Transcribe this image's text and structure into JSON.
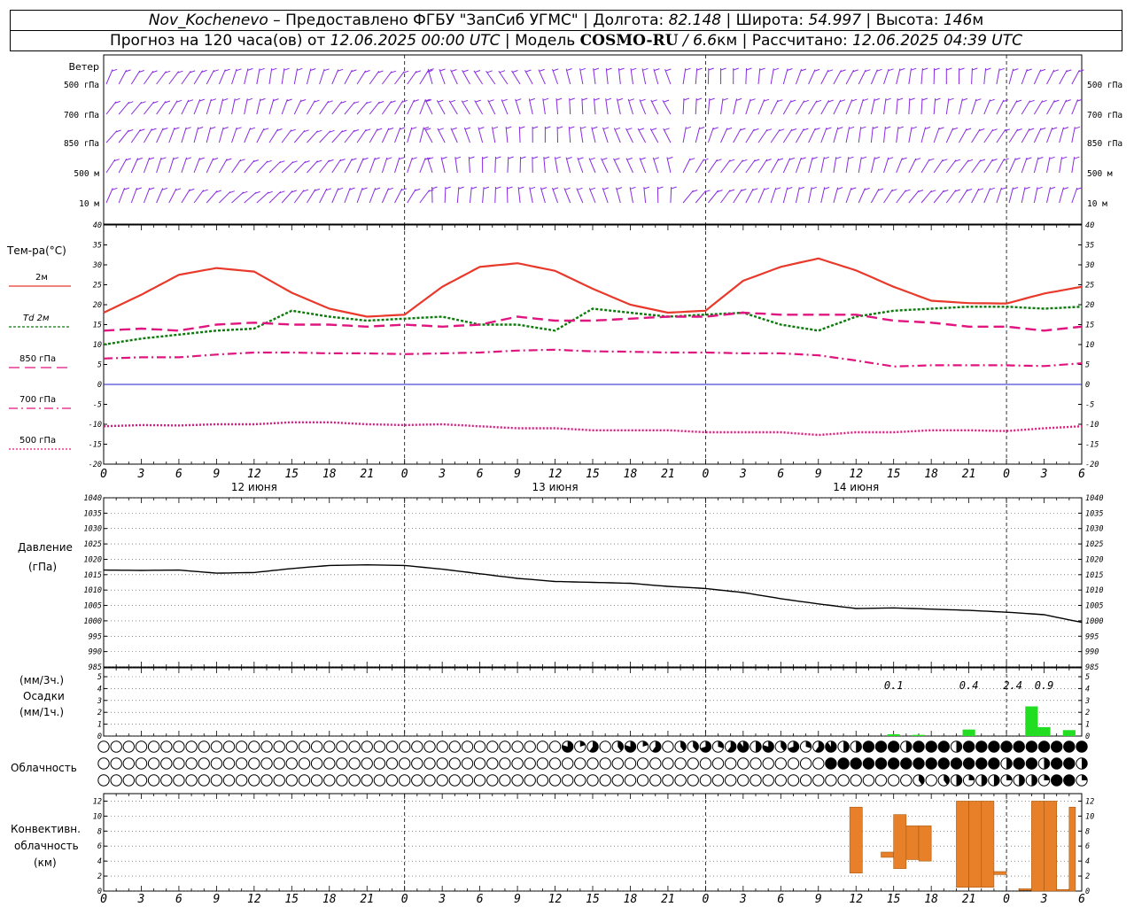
{
  "header": {
    "station": "Nov_Kochenevo",
    "dash": " – ",
    "provided": "Предоставлено ФГБУ \"ЗапСиб УГМС\"",
    "sep": " | ",
    "lon_label": "Долгота: ",
    "lon": "82.148",
    "lat_label": "Широта: ",
    "lat": "54.997",
    "alt_label": "Высота: ",
    "alt": "146",
    "alt_unit": "м",
    "fc_label": "Прогноз на 120 часа(ов) от ",
    "fc_time": "12.06.2025 00:00 UTC",
    "model_label": "Модель ",
    "model": "COSMO-RU",
    "model_res": "6.6",
    "model_res_unit": "км",
    "calc_label": "Рассчитано: ",
    "calc_time": "12.06.2025 04:39 UTC"
  },
  "colors": {
    "t2m": "#e8392b",
    "td2m": "#0b7a0b",
    "t850": "#e0157f",
    "t700": "#e0157f",
    "t500": "#e0157f",
    "wind": "#8a2be2",
    "zero": "#1e1ec8",
    "precip": "#22dd22",
    "conv": "#e8802a"
  },
  "chart_data": [
    {
      "type": "wind_barbs",
      "title": "Ветер",
      "levels": [
        "500 гПа",
        "700 гПа",
        "850 гПа",
        "500 м",
        "10  м"
      ]
    },
    {
      "type": "line",
      "ylabel": "Тем-ра(°C)",
      "ylim": [
        -20,
        40
      ],
      "yticks": [
        -20,
        -15,
        -10,
        -5,
        0,
        5,
        10,
        15,
        20,
        25,
        30,
        35,
        40
      ],
      "x_hours": [
        0,
        3,
        6,
        9,
        12,
        15,
        18,
        21,
        24,
        27,
        30,
        33,
        36,
        39,
        42,
        45,
        48,
        51,
        54,
        57,
        60,
        63,
        66,
        69,
        72,
        75,
        78
      ],
      "series": [
        {
          "name": "2м",
          "values": [
            18,
            22.5,
            27.5,
            29.2,
            28.3,
            23,
            19,
            17,
            17.5,
            24.5,
            29.5,
            30.4,
            28.5,
            24,
            20,
            18,
            18.5,
            26,
            29.5,
            31.6,
            28.6,
            24.5,
            21,
            20.4,
            20.3,
            22.8,
            24.5
          ]
        },
        {
          "name": "Td  2м",
          "values": [
            10,
            11.5,
            12.5,
            13.5,
            14,
            18.5,
            17,
            16,
            16.5,
            17,
            15,
            15,
            13.5,
            19,
            18,
            17,
            17.5,
            18,
            15,
            13.5,
            17,
            18.5,
            19,
            19.5,
            19.5,
            19,
            19.5
          ]
        },
        {
          "name": "850 гПа",
          "values": [
            13.5,
            14,
            13.5,
            15,
            15.5,
            15,
            15,
            14.5,
            15,
            14.5,
            15,
            17,
            16,
            16,
            16.5,
            17,
            17,
            18,
            17.5,
            17.5,
            17.5,
            16,
            15.5,
            14.5,
            14.5,
            13.5,
            14.5
          ]
        },
        {
          "name": "700 гПа",
          "values": [
            6.5,
            6.8,
            6.8,
            7.5,
            8,
            8,
            7.8,
            7.8,
            7.6,
            7.8,
            8,
            8.5,
            8.7,
            8.3,
            8.2,
            8,
            8,
            7.8,
            7.8,
            7.3,
            6,
            4.5,
            4.8,
            4.8,
            4.8,
            4.6,
            5.3
          ]
        },
        {
          "name": "500 гПа",
          "values": [
            -10.5,
            -10.2,
            -10.3,
            -10,
            -10,
            -9.5,
            -9.5,
            -10,
            -10.2,
            -10,
            -10.5,
            -11,
            -11,
            -11.5,
            -11.5,
            -11.5,
            -12,
            -12,
            -12,
            -12.7,
            -12,
            -12,
            -11.5,
            -11.5,
            -11.7,
            -11,
            -10.5
          ]
        }
      ]
    },
    {
      "type": "line",
      "ylabel": "Давление",
      "yunit": "(гПа)",
      "ylim": [
        985,
        1040
      ],
      "yticks": [
        985,
        990,
        995,
        1000,
        1005,
        1010,
        1015,
        1020,
        1025,
        1030,
        1035,
        1040
      ],
      "x_hours": [
        0,
        3,
        6,
        9,
        12,
        15,
        18,
        21,
        24,
        27,
        30,
        33,
        36,
        39,
        42,
        45,
        48,
        51,
        54,
        57,
        60,
        63,
        66,
        69,
        72,
        75,
        78
      ],
      "series": [
        {
          "name": "pressure",
          "values": [
            1016.5,
            1016.4,
            1016.5,
            1015.5,
            1015.7,
            1017,
            1018,
            1018.2,
            1018,
            1016.8,
            1015.3,
            1013.8,
            1012.8,
            1012.5,
            1012.2,
            1011.2,
            1010.5,
            1009.2,
            1007.2,
            1005.5,
            1004,
            1004.2,
            1003.8,
            1003.4,
            1002.8,
            1002,
            999.5
          ]
        }
      ]
    },
    {
      "type": "bar",
      "ylabel": "Осадки",
      "yunits": [
        "(мм/3ч.)",
        "(мм/1ч.)"
      ],
      "ylim": [
        0,
        5
      ],
      "yticks": [
        0,
        1,
        2,
        3,
        4,
        5
      ],
      "annotations": [
        {
          "x_hour": 63,
          "text": "0.1"
        },
        {
          "x_hour": 69,
          "text": "0.4"
        },
        {
          "x_hour": 72.5,
          "text": "2.4"
        },
        {
          "x_hour": 75,
          "text": "0.9"
        }
      ],
      "bars": [
        {
          "x_hour": 63,
          "value": 0.15
        },
        {
          "x_hour": 65,
          "value": 0.1
        },
        {
          "x_hour": 69,
          "value": 0.55
        },
        {
          "x_hour": 74,
          "value": 2.5
        },
        {
          "x_hour": 75,
          "value": 0.75
        },
        {
          "x_hour": 77,
          "value": 0.5
        }
      ]
    },
    {
      "type": "table",
      "ylabel": "Облачность",
      "note": "cloud cover fraction (0–1) per layer per hour",
      "rows": [
        {
          "name": "upper",
          "values": "0000000000000000000000000000000000000.10.50.60.60.50.40.2000.10.40.70.60.80.70.70.30.10.20.40.50.80.91110.80.60.40.70.80.91111111110.60.2111111111111111111111110.50.8111111110.610.80.5"
        },
        {
          "name": "middle",
          "values": "000000000000000000000000000000000000000000000000000000000000000000000000000000000000000000000000000000000000000000000000000000000000000000000.20.8111111111111111111110.50.50.70.50.50.5111110.8111111111"
        },
        {
          "name": "lower",
          "values": "00000000000000000000000000000000000000000000000000000000000000000000000000000000000000000000000000000000000000000000000000000000000000000000000000000000000000000000000000000000.400000.20.500000.20.40.50.30.210.30.810.20.80.60.30.61111"
        }
      ]
    },
    {
      "type": "bar",
      "ylabel": "Конвективн. облачность",
      "yunit": "(км)",
      "ylim": [
        0,
        13
      ],
      "yticks": [
        0,
        2,
        4,
        6,
        8,
        10,
        12
      ],
      "bars": [
        {
          "x_from": 59.5,
          "x_to": 60.5,
          "base": 2.4,
          "top": 11.2
        },
        {
          "x_from": 62,
          "x_to": 63,
          "base": 4.5,
          "top": 5.2
        },
        {
          "x_from": 63,
          "x_to": 64,
          "base": 3,
          "top": 10.2
        },
        {
          "x_from": 64,
          "x_to": 65,
          "base": 4.2,
          "top": 8.7
        },
        {
          "x_from": 65,
          "x_to": 66,
          "base": 4,
          "top": 8.7
        },
        {
          "x_from": 68,
          "x_to": 69,
          "base": 0.5,
          "top": 12
        },
        {
          "x_from": 69,
          "x_to": 70,
          "base": 0.5,
          "top": 12
        },
        {
          "x_from": 70,
          "x_to": 71,
          "base": 0.5,
          "top": 12
        },
        {
          "x_from": 71,
          "x_to": 72,
          "base": 2.2,
          "top": 2.6
        },
        {
          "x_from": 73,
          "x_to": 74,
          "base": 0.1,
          "top": 0.3
        },
        {
          "x_from": 74,
          "x_to": 75,
          "base": 0,
          "top": 12
        },
        {
          "x_from": 75,
          "x_to": 76,
          "base": 0,
          "top": 12
        },
        {
          "x_from": 76,
          "x_to": 77,
          "base": 0,
          "top": 0.2
        },
        {
          "x_from": 77,
          "x_to": 77.5,
          "base": 0,
          "top": 11.2
        }
      ]
    }
  ],
  "time_axis": {
    "hour_ticks": [
      "0",
      "3",
      "6",
      "9",
      "12",
      "15",
      "18",
      "21",
      "0",
      "3",
      "6",
      "9",
      "12",
      "15",
      "18",
      "21",
      "0",
      "3",
      "6",
      "9",
      "12",
      "15",
      "18",
      "21",
      "0",
      "3",
      "6"
    ],
    "days": [
      "12 июня",
      "13 июня",
      "14 июня"
    ]
  },
  "legend": {
    "t2m": "2м",
    "td2m": "Td  2м",
    "t850": "850 гПа",
    "t700": "700 гПа",
    "t500": "500 гПа"
  }
}
